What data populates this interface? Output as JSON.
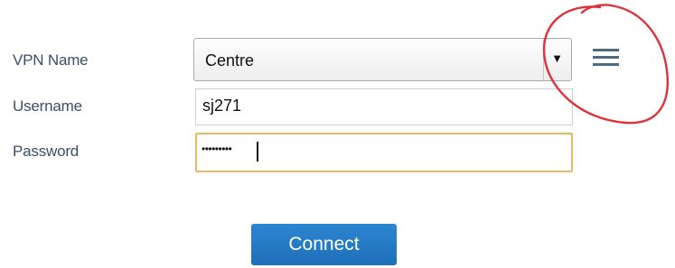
{
  "form": {
    "vpn_name_label": "VPN Name",
    "username_label": "Username",
    "password_label": "Password",
    "vpn_name_value": "Centre",
    "select_arrow": "▼",
    "username_value": "sj271",
    "password_masked": "•••••••••",
    "connect_label": "Connect"
  },
  "icons": {
    "menu": "hamburger-menu-icon",
    "dropdown": "triangle-down-icon"
  },
  "colors": {
    "label_text": "#3a4f66",
    "button_bg": "#2a80c9",
    "focus_border": "#e8b962",
    "menu_icon": "#4f6b82",
    "annotation_circle": "#e0303a"
  }
}
